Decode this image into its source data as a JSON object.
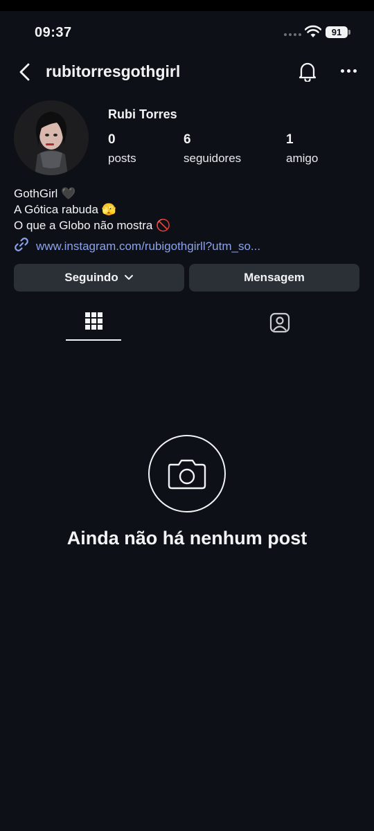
{
  "status_bar": {
    "time": "09:37",
    "battery": "91"
  },
  "header": {
    "username": "rubitorresgothgirl"
  },
  "profile": {
    "display_name": "Rubi Torres",
    "stats": [
      {
        "value": "0",
        "label": "posts"
      },
      {
        "value": "6",
        "label": "seguidores"
      },
      {
        "value": "1",
        "label": "amigo"
      }
    ],
    "bio": [
      "GothGirl 🖤",
      "A Gótica rabuda 🫣",
      "O que a Globo não mostra 🚫"
    ],
    "link": "www.instagram.com/rubigothgirll?utm_so..."
  },
  "actions": {
    "following_label": "Seguindo",
    "message_label": "Mensagem"
  },
  "empty_state": {
    "text": "Ainda não há nenhum post"
  }
}
